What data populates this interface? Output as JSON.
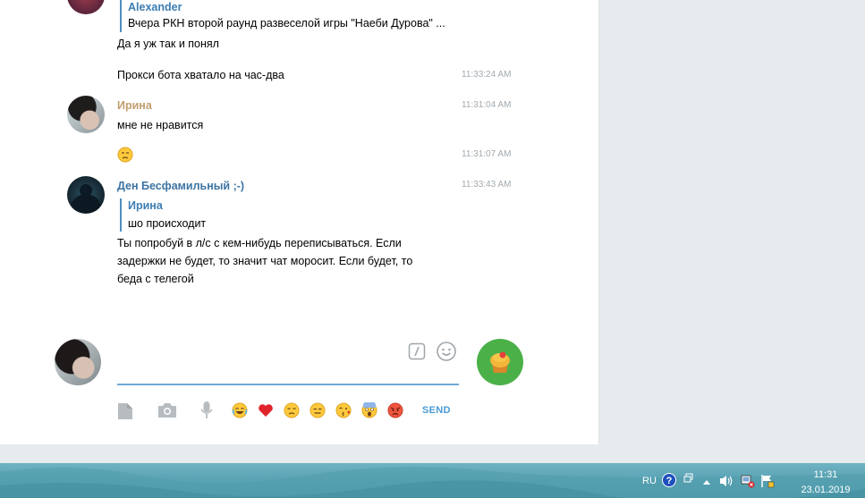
{
  "messages": {
    "top_reply": {
      "name": "Alexander",
      "text": "Вчера РКН второй раунд развеселой игры \"Наеби Дурова\" ..."
    },
    "top_text": "Да я уж так и понял",
    "proxy": {
      "text": "Прокси  бота хватало на час-два",
      "time": "11:33:24 AM"
    },
    "irina": {
      "name": "Ирина",
      "text": "мне не нравится",
      "time": "11:31:04 AM",
      "time2": "11:31:07 AM",
      "name_color": "#c19d6e"
    },
    "den": {
      "name": "Ден Бесфамильный ;-)",
      "time": "11:33:43 AM",
      "reply_name": "Ирина",
      "reply_text": "шо происходит",
      "lines": [
        "Ты попробуй в л/с с кем-нибудь переписываться. Если",
        "задержки не будет, то значит чат моросит. Если будет, то",
        "беда с телегой"
      ],
      "name_color": "#3d74a3"
    }
  },
  "composer": {
    "placeholder": "",
    "send_label": "SEND",
    "emoji_bar": [
      "joy-face",
      "heart",
      "unamused-face",
      "expressionless-face",
      "kiss-face",
      "scream-face",
      "angry-face"
    ],
    "accent": "#4cb049"
  },
  "taskbar": {
    "lang": "RU",
    "time": "11:31",
    "date": "23.01.2019"
  }
}
